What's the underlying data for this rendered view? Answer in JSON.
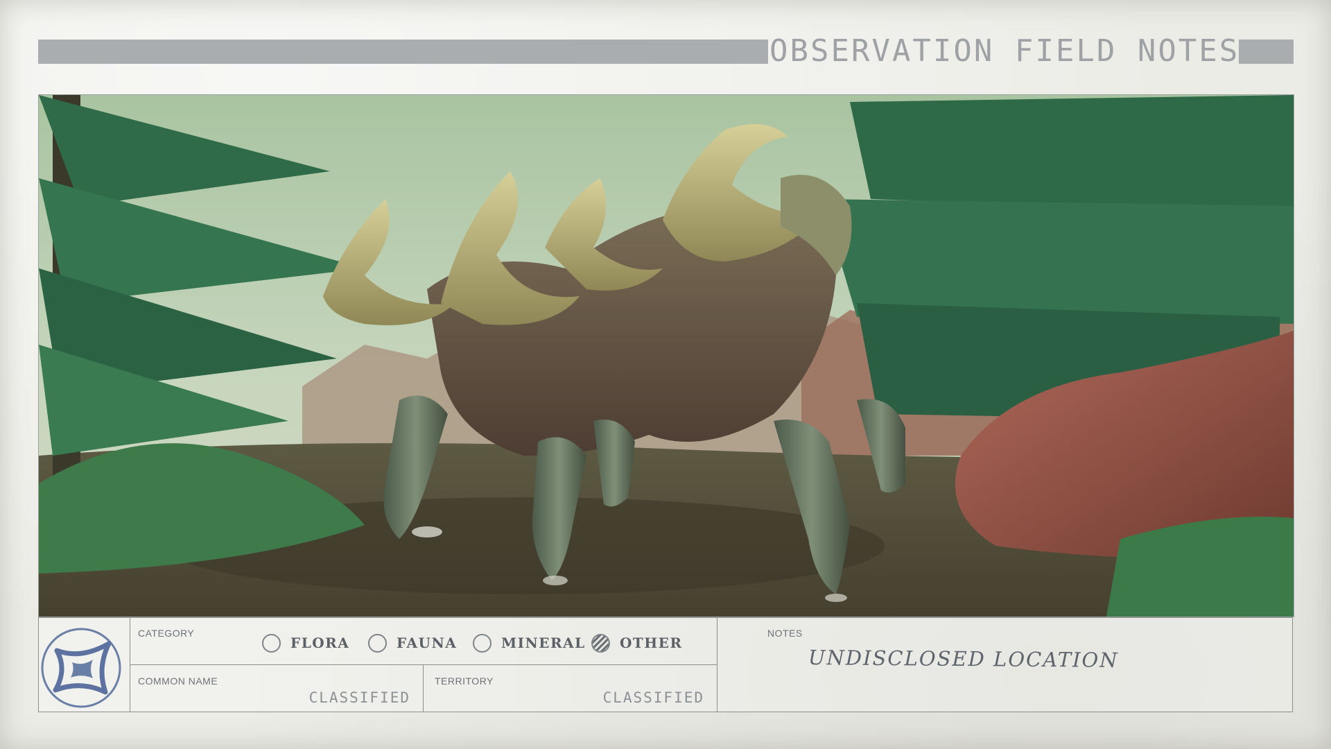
{
  "header": {
    "title": "OBSERVATION FIELD NOTES"
  },
  "photo": {
    "subject": "alien-creature"
  },
  "footer": {
    "logo_icon": "starburst-emblem-icon",
    "category": {
      "label": "CATEGORY",
      "options": [
        {
          "label": "FLORA",
          "checked": false
        },
        {
          "label": "FAUNA",
          "checked": false
        },
        {
          "label": "MINERAL",
          "checked": false
        },
        {
          "label": "OTHER",
          "checked": true
        }
      ]
    },
    "common_name": {
      "label": "COMMON NAME",
      "value": "CLASSIFIED"
    },
    "territory": {
      "label": "TERRITORY",
      "value": "CLASSIFIED"
    },
    "notes": {
      "label": "NOTES",
      "value": "UNDISCLOSED LOCATION"
    }
  },
  "colors": {
    "paper": "#ecece7",
    "header_bar": "#a9adaf",
    "ink": "#5b6166",
    "notes_ink": "#5d646c"
  }
}
